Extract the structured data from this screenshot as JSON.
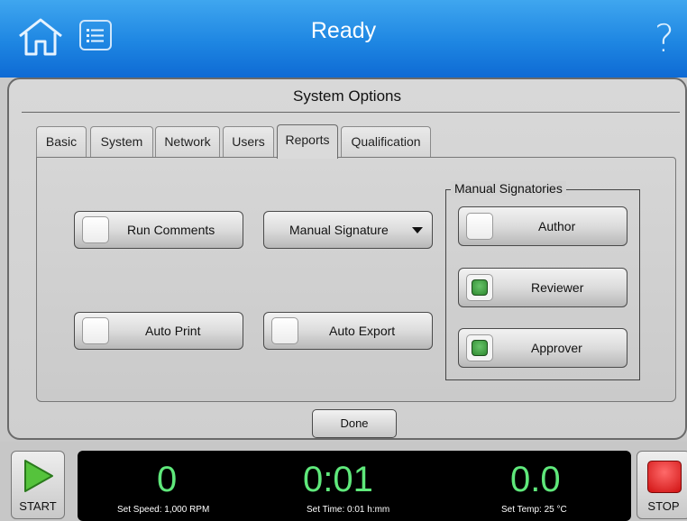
{
  "header": {
    "title": "Ready",
    "help_glyph": "?",
    "home_icon": "home-icon",
    "menu_icon": "list-menu-icon"
  },
  "dialog": {
    "title": "System Options",
    "tabs": [
      {
        "label": "Basic",
        "active": false
      },
      {
        "label": "System",
        "active": false
      },
      {
        "label": "Network",
        "active": false
      },
      {
        "label": "Users",
        "active": false
      },
      {
        "label": "Reports",
        "active": true
      },
      {
        "label": "Qualification",
        "active": false
      }
    ],
    "options": {
      "run_comments": {
        "label": "Run Comments",
        "checked": false
      },
      "auto_print": {
        "label": "Auto Print",
        "checked": false
      },
      "auto_export": {
        "label": "Auto Export",
        "checked": false
      },
      "manual_signature": {
        "label": "Manual Signature"
      }
    },
    "signatories": {
      "legend": "Manual Signatories",
      "items": [
        {
          "label": "Author",
          "checked": false
        },
        {
          "label": "Reviewer",
          "checked": true
        },
        {
          "label": "Approver",
          "checked": true
        }
      ]
    },
    "done_label": "Done"
  },
  "status": {
    "start_label": "START",
    "stop_label": "STOP",
    "speed_value": "0",
    "speed_sub": "Set Speed: 1,000 RPM",
    "time_value": "0:01",
    "time_sub": "Set Time: 0:01 h:mm",
    "temp_value": "0.0",
    "temp_sub": "Set Temp: 25 °C"
  },
  "colors": {
    "header_blue": "#1e86e2",
    "readout_green": "#5fe87b",
    "checked_green": "#2e8a30",
    "stop_red": "#d01212"
  }
}
